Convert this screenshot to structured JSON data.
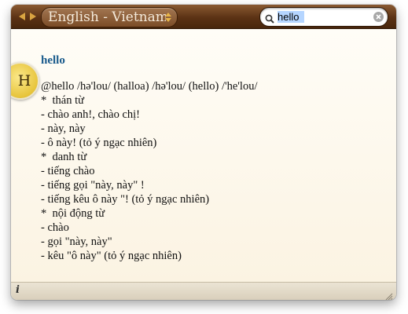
{
  "toolbar": {
    "dictionary_label": "English - Vietnamese",
    "back_icon": "back-arrow-icon",
    "forward_icon": "forward-arrow-icon"
  },
  "search": {
    "value": "hello",
    "icon": "magnifier-icon",
    "clear_icon": "clear-icon"
  },
  "entry": {
    "badge_letter": "H",
    "headword": "hello",
    "lines": [
      "@hello /hə'lou/ (halloa) /hə'lou/ (hello) /'he'lou/",
      "*  thán từ",
      "- chào anh!, chào chị!",
      "- này, này",
      "- ô này! (tỏ ý ngạc nhiên)",
      "*  danh từ",
      "- tiếng chào",
      "- tiếng gọi \"này, này\" !",
      "- tiếng kêu ô này \"! (tỏ ý ngạc nhiên)",
      "*  nội động từ",
      "- chào",
      "- gọi \"này, này\"",
      "- kêu \"ô này\" (tỏ ý ngạc nhiên)"
    ]
  },
  "statusbar": {
    "info_label": "i",
    "resize_icon": "resize-grip-icon"
  },
  "colors": {
    "toolbar": "#5b3214",
    "headword": "#1a5b8c",
    "badge": "#e7c43b",
    "content_bg": "#fdf8ed"
  }
}
